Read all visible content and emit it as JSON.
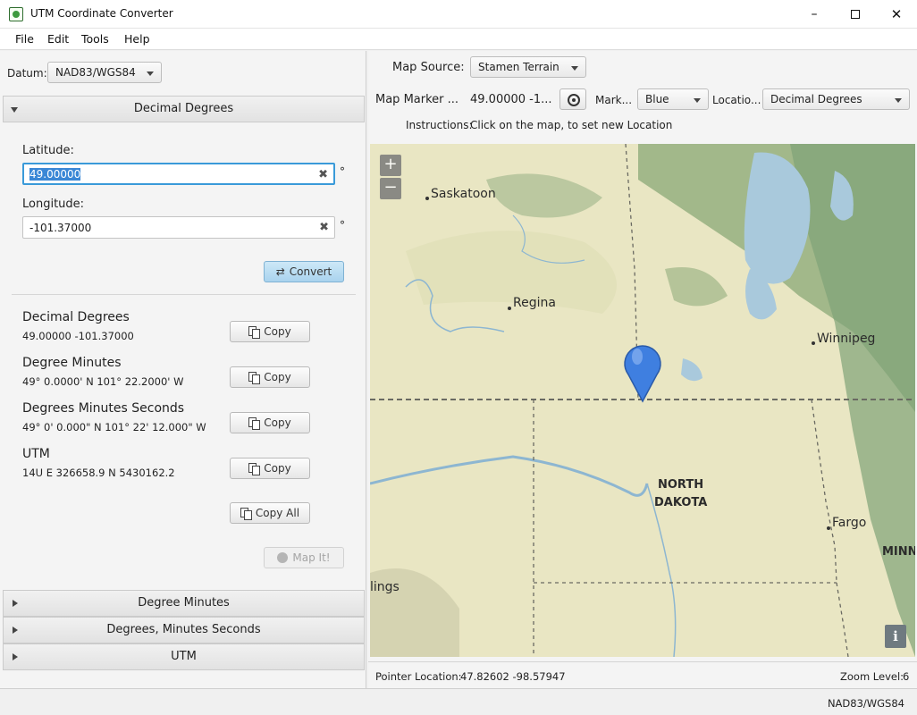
{
  "window": {
    "title": "UTM Coordinate Converter",
    "minimize": "–",
    "close": "✕"
  },
  "menu": [
    "File",
    "Edit",
    "Tools",
    "Help"
  ],
  "left": {
    "datum_label": "Datum:",
    "datum_value": "NAD83/WGS84",
    "sections": [
      "Decimal Degrees",
      "Degree Minutes",
      "Degrees, Minutes Seconds",
      "UTM"
    ],
    "latitude_label": "Latitude:",
    "latitude_value": "49.00000",
    "longitude_label": "Longitude:",
    "longitude_value": "-101.37000",
    "degree_symbol": "°",
    "clear_symbol": "✖",
    "convert_label": "Convert",
    "convert_icon": "⇄",
    "results": [
      {
        "title": "Decimal Degrees",
        "value": "49.00000 -101.37000"
      },
      {
        "title": "Degree Minutes",
        "value": "49° 0.0000' N 101° 22.2000' W"
      },
      {
        "title": "Degrees Minutes Seconds",
        "value": "49° 0' 0.000\" N 101° 22' 12.000\" W"
      },
      {
        "title": "UTM",
        "value": "14U E 326658.9 N 5430162.2"
      }
    ],
    "copy_label": "Copy",
    "copy_all_label": "Copy All",
    "map_it_label": "Map It!"
  },
  "right": {
    "map_source_label": "Map Source:",
    "map_source_value": "Stamen Terrain",
    "map_marker_label": "Map Marker ...",
    "map_marker_value": "49.00000 -1...",
    "marker_color_label": "Mark...",
    "marker_color_value": "Blue",
    "location_label": "Locatio...",
    "location_format_value": "Decimal Degrees",
    "instructions_label": "Instructions:",
    "instructions_text": "Click on the map, to set new Location",
    "zoom_in": "+",
    "zoom_out": "−",
    "info": "i",
    "map_labels": {
      "saskatoon": "Saskatoon",
      "regina": "Regina",
      "winnipeg": "Winnipeg",
      "north": "NORTH",
      "dakota": "DAKOTA",
      "fargo": "Fargo",
      "minn": "MINN",
      "lings": "lings"
    },
    "pointer_label": "Pointer Location:",
    "pointer_value": "47.82602 -98.57947",
    "zoom_label": "Zoom Level:",
    "zoom_value": "6"
  },
  "status": {
    "datum": "NAD83/WGS84"
  },
  "colors": {
    "accent": "#3a9ad9",
    "marker": "#3f7fe0",
    "water": "#a9c9dc",
    "forest": "#7fa277"
  }
}
